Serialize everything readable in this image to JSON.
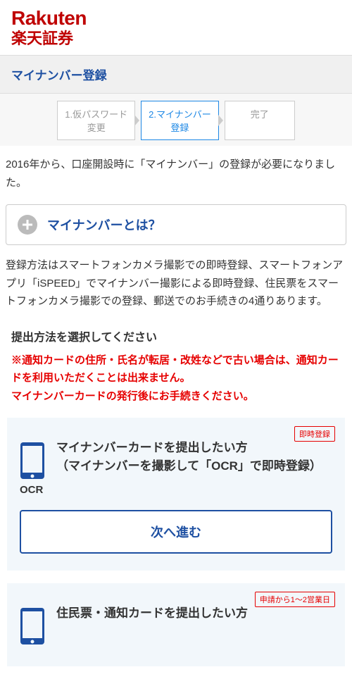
{
  "logo": {
    "rakuten": "Rakuten",
    "shoken": "楽天証券"
  },
  "page_title": "マイナンバー登録",
  "steps": [
    {
      "label": "1.仮パスワード\n変更"
    },
    {
      "label": "2.マイナンバー\n登録"
    },
    {
      "label": "完了"
    }
  ],
  "intro": "2016年から、口座開設時に「マイナンバー」の登録が必要になりました。",
  "expander": {
    "label": "マイナンバーとは？"
  },
  "desc": "登録方法はスマートフォンカメラ撮影での即時登録、スマートフォンアプリ「iSPEED」でマイナンバー撮影による即時登録、住民票をスマートフォンカメラ撮影での登録、郵送でのお手続きの4通りあります。",
  "section_title": "提出方法を選択してください",
  "warning": "※通知カードの住所・氏名が転居・改姓などで古い場合は、通知カードを利用いただくことは出来ません。\nマイナンバーカードの発行後にお手続きください。",
  "option1": {
    "badge": "即時登録",
    "title": "マイナンバーカードを提出したい方\n（マイナンバーを撮影して「OCR」で即時登録）",
    "ocr": "OCR",
    "next": "次へ進む"
  },
  "option2": {
    "badge": "申請から1～2営業日",
    "title": "住民票・通知カードを提出したい方"
  }
}
